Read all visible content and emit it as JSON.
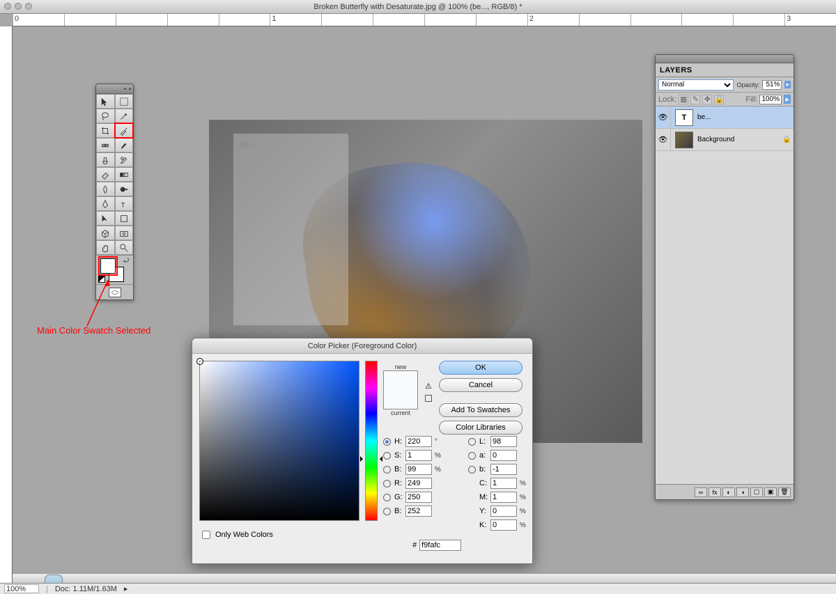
{
  "window": {
    "title": "Broken Butterfly with Desaturate.jpg @ 100% (be..., RGB/8) *"
  },
  "ruler_h": [
    "0",
    "",
    "",
    "",
    "",
    "1",
    "",
    "",
    "",
    "",
    "2",
    "",
    "",
    "",
    "",
    "3"
  ],
  "annotation": "Main Color Swatch Selected",
  "canvas_text": "be....",
  "layers": {
    "tab": "LAYERS",
    "blend_mode": "Normal",
    "opacity_label": "Opacity:",
    "opacity": "51%",
    "fill_label": "Fill:",
    "fill": "100%",
    "lock_label": "Lock:",
    "rows": [
      {
        "name": "be...",
        "thumb": "T",
        "locked": false,
        "selected": true
      },
      {
        "name": "Background",
        "thumb": "img",
        "locked": true,
        "selected": false
      }
    ]
  },
  "dialog": {
    "title": "Color Picker (Foreground Color)",
    "new_label": "new",
    "current_label": "current",
    "ok": "OK",
    "cancel": "Cancel",
    "add": "Add To Swatches",
    "libs": "Color Libraries",
    "only_web": "Only Web Colors",
    "H": "220",
    "H_u": "°",
    "S": "1",
    "S_u": "%",
    "Bv": "99",
    "Bv_u": "%",
    "R": "249",
    "G": "250",
    "Bc": "252",
    "L": "98",
    "a": "0",
    "b": "-1",
    "C": "1",
    "C_u": "%",
    "M": "1",
    "M_u": "%",
    "Y": "0",
    "Y_u": "%",
    "K": "0",
    "K_u": "%",
    "hex_label": "#",
    "hex": "f9fafc",
    "selected_model": "H"
  },
  "status": {
    "zoom": "100%",
    "doc": "Doc: 1.11M/1.63M"
  }
}
